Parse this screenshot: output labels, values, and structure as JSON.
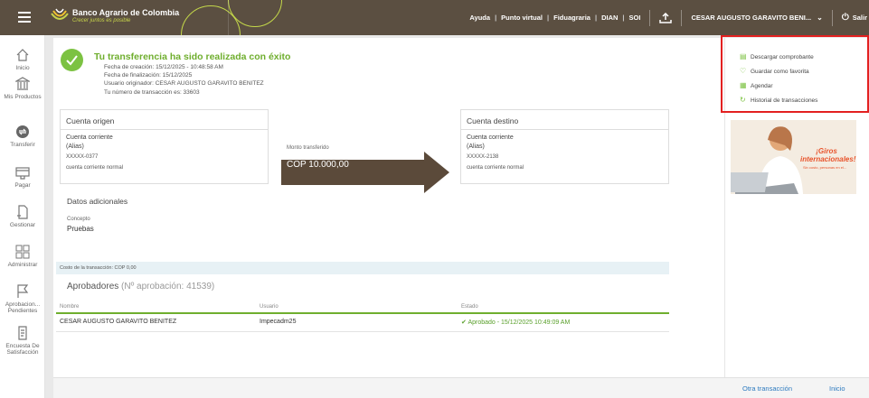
{
  "header": {
    "brand": "Banco Agrario de Colombia",
    "tagline": "Crecer juntos es posible",
    "nav": [
      "Ayuda",
      "Punto virtual",
      "Fiduagraria",
      "DIAN",
      "SOI"
    ],
    "user": "CESAR AUGUSTO GARAVITO BENI...",
    "logout": "Salir"
  },
  "sidebar": {
    "items": [
      {
        "label": "Inicio",
        "icon": "home-icon"
      },
      {
        "label": "Mis Productos",
        "icon": "bank-icon"
      },
      {
        "label": "Transferir",
        "icon": "transfer-icon"
      },
      {
        "label": "Pagar",
        "icon": "pay-icon"
      },
      {
        "label": "Gestionar",
        "icon": "manage-icon"
      },
      {
        "label": "Administrar",
        "icon": "admin-icon"
      },
      {
        "label": "Aprobacion... Pendientes",
        "icon": "flag-icon"
      },
      {
        "label": "Encuesta De Satisfacción",
        "icon": "survey-icon"
      }
    ]
  },
  "result": {
    "title": "Tu transferencia ha sido realizada con éxito",
    "created": "Fecha de creación: 15/12/2025 - 10:48:58 AM",
    "finished": "Fecha de finalización: 15/12/2025",
    "originator": "Usuario originador: CESAR AUGUSTO GARAVITO BENITEZ",
    "transaction": "Tu número de transacción es: 33603"
  },
  "origin": {
    "title": "Cuenta origen",
    "type": "Cuenta corriente",
    "alias": "(Alias)",
    "number": "XXXXX-0377",
    "desc": "cuenta corriente normal"
  },
  "transfer": {
    "label": "Monto transferido",
    "amount": "COP 10.000,00"
  },
  "destination": {
    "title": "Cuenta destino",
    "type": "Cuenta corriente",
    "alias": "(Alias)",
    "number": "XXXXX-2138",
    "desc": "cuenta corriente normal"
  },
  "additional": {
    "title": "Datos adicionales",
    "concept_label": "Concepto",
    "concept_value": "Pruebas"
  },
  "cost": "Costo de la transacción: COP 0,00",
  "approvers": {
    "title": "Aprobadores",
    "number": "(Nº aprobación: 41539)",
    "headers": [
      "Nombre",
      "Usuario",
      "Estado"
    ],
    "rows": [
      {
        "name": "CESAR AUGUSTO GARAVITO BENITEZ",
        "user": "Impecadm25",
        "status": "Aprobado - 15/12/2025 10:49:09 AM"
      }
    ]
  },
  "actions": [
    {
      "label": "Descargar comprobante",
      "icon": "download-icon"
    },
    {
      "label": "Guardar como favorita",
      "icon": "heart-icon"
    },
    {
      "label": "Agendar",
      "icon": "calendar-icon"
    },
    {
      "label": "Historial de transacciones",
      "icon": "history-icon"
    }
  ],
  "promo": {
    "title": "¡Giros internacionales!",
    "subtitle": "Sin costo, personas en el..."
  },
  "footer": {
    "other": "Otra transacción",
    "home": "Inicio"
  },
  "colors": {
    "header": "#5b4f41",
    "accent_green": "#7cc242",
    "arrow": "#5b4a3a",
    "highlight_red": "#e32020",
    "link": "#2e7bbf"
  }
}
